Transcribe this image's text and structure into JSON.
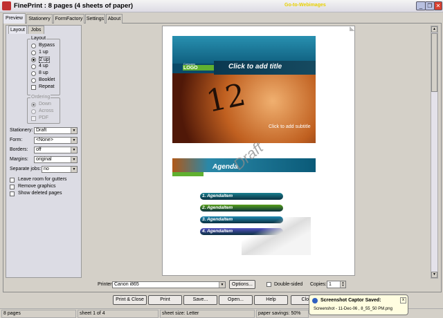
{
  "window": {
    "title": "FinePrint : 8 pages (4 sheets of paper)",
    "watermark": "Go-to-Webimages",
    "min": "_",
    "max": "❐",
    "close": "✕"
  },
  "tabs": [
    "Preview",
    "Stationery",
    "FormFactory",
    "Settings",
    "About"
  ],
  "subtabs": [
    "Layout",
    "Jobs"
  ],
  "layout": {
    "label": "Layout",
    "options": [
      "Bypass",
      "1 up",
      "2 up",
      "4 up",
      "8 up",
      "Booklet"
    ],
    "selected": "2 up",
    "repeat": "Repeat"
  },
  "ordering": {
    "label": "Ordering",
    "options": [
      "Down",
      "Across",
      "PDF"
    ]
  },
  "fields": [
    {
      "label": "Stationery:",
      "value": "Draft"
    },
    {
      "label": "Form:",
      "value": "<None>"
    },
    {
      "label": "Borders:",
      "value": "off"
    },
    {
      "label": "Margins:",
      "value": "original"
    },
    {
      "label": "Separate jobs:",
      "value": "no"
    }
  ],
  "checks": [
    "Leave room for gutters",
    "Remove graphics",
    "Show deleted pages"
  ],
  "preview": {
    "company": "Company",
    "logo": "LOGO",
    "title": "Click to add title",
    "subtitle": "Click to add subtitle",
    "clock": "12",
    "agenda": "Agenda",
    "stamp": "Draft",
    "items": [
      {
        "text": "1. AgendaItem",
        "color": "#1a8090"
      },
      {
        "text": "2. AgendaItem",
        "color": "#58a018"
      },
      {
        "text": "3. AgendaItem",
        "color": "#2088b0"
      },
      {
        "text": "4. AgendaItem",
        "color": "#5050c0"
      }
    ]
  },
  "printer": {
    "label": "Printer:",
    "value": "Canon i865",
    "options": "Options...",
    "duplex": "Double-sided",
    "copies_label": "Copies:",
    "copies": "1"
  },
  "buttons": [
    "Print & Close",
    "Print",
    "Save...",
    "Open...",
    "Help",
    "Close"
  ],
  "toast": {
    "title": "Screenshot Captor Saved:",
    "text": "Screenshot - 11-Dec-06 , 8_55_50 PM.png",
    "close": "x"
  },
  "status": [
    "8 pages",
    "sheet 1 of 4",
    "sheet size: Letter",
    "paper savings: 50%"
  ]
}
